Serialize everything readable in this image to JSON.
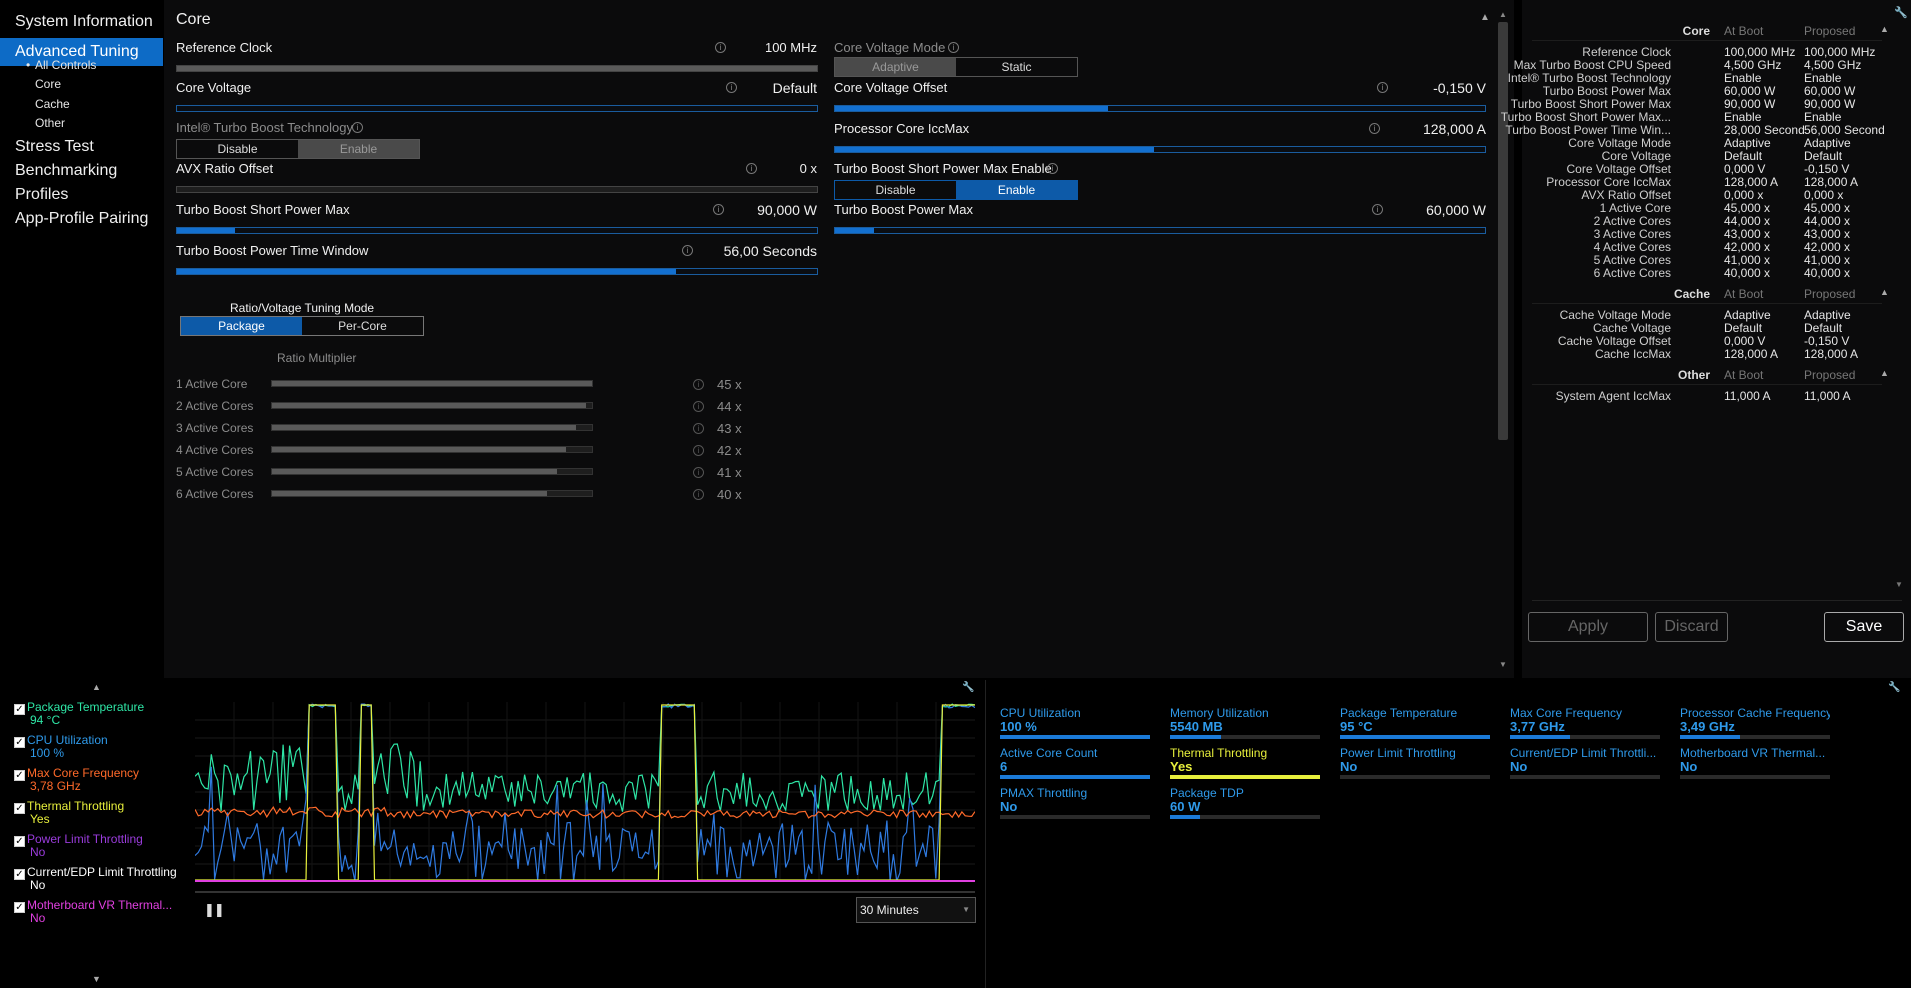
{
  "sidebar": {
    "items": [
      "System Information",
      "Advanced Tuning",
      "Stress Test",
      "Benchmarking",
      "Profiles",
      "App-Profile Pairing"
    ],
    "subitems": [
      "All Controls",
      "Core",
      "Cache",
      "Other"
    ]
  },
  "main": {
    "title": "Core",
    "reference_clock": {
      "label": "Reference Clock",
      "value": "100 MHz"
    },
    "core_voltage_mode": {
      "label": "Core Voltage Mode",
      "options": [
        "Adaptive",
        "Static"
      ]
    },
    "core_voltage": {
      "label": "Core Voltage",
      "value": "Default"
    },
    "core_voltage_offset": {
      "label": "Core Voltage Offset",
      "value": "-0,150 V",
      "level": 0.42
    },
    "turbo_boost_tech": {
      "label": "Intel® Turbo Boost Technology",
      "options": [
        "Disable",
        "Enable"
      ]
    },
    "iccmax": {
      "label": "Processor Core IccMax",
      "value": "128,000 A",
      "level": 0.49
    },
    "avx": {
      "label": "AVX Ratio Offset",
      "value": "0 x"
    },
    "tbspm_enable": {
      "label": "Turbo Boost Short Power Max Enable",
      "options": [
        "Disable",
        "Enable"
      ]
    },
    "tbspm": {
      "label": "Turbo Boost Short Power Max",
      "value": "90,000 W",
      "level": 0.09
    },
    "tbpm": {
      "label": "Turbo Boost Power Max",
      "value": "60,000 W",
      "level": 0.06
    },
    "tbptw": {
      "label": "Turbo Boost Power Time Window",
      "value": "56,00 Seconds",
      "level": 0.78
    },
    "ratio_mode": {
      "label": "Ratio/Voltage Tuning Mode",
      "options": [
        "Package",
        "Per-Core"
      ]
    },
    "ratio_multiplier_label": "Ratio Multiplier",
    "ratios": [
      {
        "label": "1 Active Core",
        "value": "45 x",
        "level": 1.0
      },
      {
        "label": "2 Active Cores",
        "value": "44 x",
        "level": 0.98
      },
      {
        "label": "3 Active Cores",
        "value": "43 x",
        "level": 0.95
      },
      {
        "label": "4 Active Cores",
        "value": "42 x",
        "level": 0.92
      },
      {
        "label": "5 Active Cores",
        "value": "41 x",
        "level": 0.89
      },
      {
        "label": "6 Active Cores",
        "value": "40 x",
        "level": 0.86
      }
    ]
  },
  "summary": {
    "col_at_boot": "At Boot",
    "col_proposed": "Proposed",
    "sections": [
      {
        "title": "Core",
        "rows": [
          [
            "Reference Clock",
            "100,000 MHz",
            "100,000 MHz"
          ],
          [
            "Max Turbo Boost CPU Speed",
            "4,500 GHz",
            "4,500 GHz"
          ],
          [
            "Intel® Turbo Boost Technology",
            "Enable",
            "Enable"
          ],
          [
            "Turbo Boost Power Max",
            "60,000 W",
            "60,000 W"
          ],
          [
            "Turbo Boost Short Power Max",
            "90,000 W",
            "90,000 W"
          ],
          [
            "Turbo Boost Short Power Max...",
            "Enable",
            "Enable"
          ],
          [
            "Turbo Boost Power Time Win...",
            "28,000 Seconds",
            "56,000 Seconds"
          ],
          [
            "Core Voltage Mode",
            "Adaptive",
            "Adaptive"
          ],
          [
            "Core Voltage",
            "Default",
            "Default"
          ],
          [
            "Core Voltage Offset",
            "0,000 V",
            "-0,150 V"
          ],
          [
            "Processor Core IccMax",
            "128,000 A",
            "128,000 A"
          ],
          [
            "AVX Ratio Offset",
            "0,000 x",
            "0,000 x"
          ],
          [
            "1 Active Core",
            "45,000 x",
            "45,000 x"
          ],
          [
            "2 Active Cores",
            "44,000 x",
            "44,000 x"
          ],
          [
            "3 Active Cores",
            "43,000 x",
            "43,000 x"
          ],
          [
            "4 Active Cores",
            "42,000 x",
            "42,000 x"
          ],
          [
            "5 Active Cores",
            "41,000 x",
            "41,000 x"
          ],
          [
            "6 Active Cores",
            "40,000 x",
            "40,000 x"
          ]
        ]
      },
      {
        "title": "Cache",
        "rows": [
          [
            "Cache Voltage Mode",
            "Adaptive",
            "Adaptive"
          ],
          [
            "Cache Voltage",
            "Default",
            "Default"
          ],
          [
            "Cache Voltage Offset",
            "0,000 V",
            "-0,150 V"
          ],
          [
            "Cache IccMax",
            "128,000 A",
            "128,000 A"
          ]
        ]
      },
      {
        "title": "Other",
        "rows": [
          [
            "System Agent IccMax",
            "11,000 A",
            "11,000 A"
          ]
        ]
      }
    ],
    "buttons": {
      "apply": "Apply",
      "discard": "Discard",
      "save": "Save"
    }
  },
  "monitor": {
    "legend": [
      {
        "name": "Package Temperature",
        "value": "94 °C",
        "color": "#2ee6a6"
      },
      {
        "name": "CPU Utilization",
        "value": "100 %",
        "color": "#2f9aea"
      },
      {
        "name": "Max Core Frequency",
        "value": "3,78 GHz",
        "color": "#ff6a2a"
      },
      {
        "name": "Thermal Throttling",
        "value": "Yes",
        "color": "#e8f03c"
      },
      {
        "name": "Power Limit Throttling",
        "value": "No",
        "color": "#9a3cdc"
      },
      {
        "name": "Current/EDP Limit Throttling",
        "value": "No",
        "color": "#ffffff"
      },
      {
        "name": "Motherboard VR Thermal...",
        "value": "No",
        "color": "#e040e0"
      }
    ],
    "time_range": "30 Minutes",
    "metrics": [
      {
        "name": "CPU Utilization",
        "value": "100 %",
        "level": 1.0
      },
      {
        "name": "Memory Utilization",
        "value": "5540  MB",
        "level": 0.34
      },
      {
        "name": "Package Temperature",
        "value": "95 °C",
        "level": 1.0
      },
      {
        "name": "Max Core Frequency",
        "value": "3,77 GHz",
        "level": 0.4
      },
      {
        "name": "Processor Cache Frequency",
        "value": "3,49 GHz",
        "level": 0.4
      },
      {
        "name": "Active Core Count",
        "value": "6",
        "level": 1.0
      },
      {
        "name": "Thermal Throttling",
        "value": "Yes",
        "level": 1.0,
        "color": "#e8f03c"
      },
      {
        "name": "Power Limit Throttling",
        "value": "No",
        "level": 0
      },
      {
        "name": "Current/EDP Limit Throttli...",
        "value": "No",
        "level": 0
      },
      {
        "name": "Motherboard VR Thermal...",
        "value": "No",
        "level": 0
      },
      {
        "name": "PMAX Throttling",
        "value": "No",
        "level": 0
      },
      {
        "name": "Package TDP",
        "value": "60 W",
        "level": 0.2
      }
    ]
  }
}
